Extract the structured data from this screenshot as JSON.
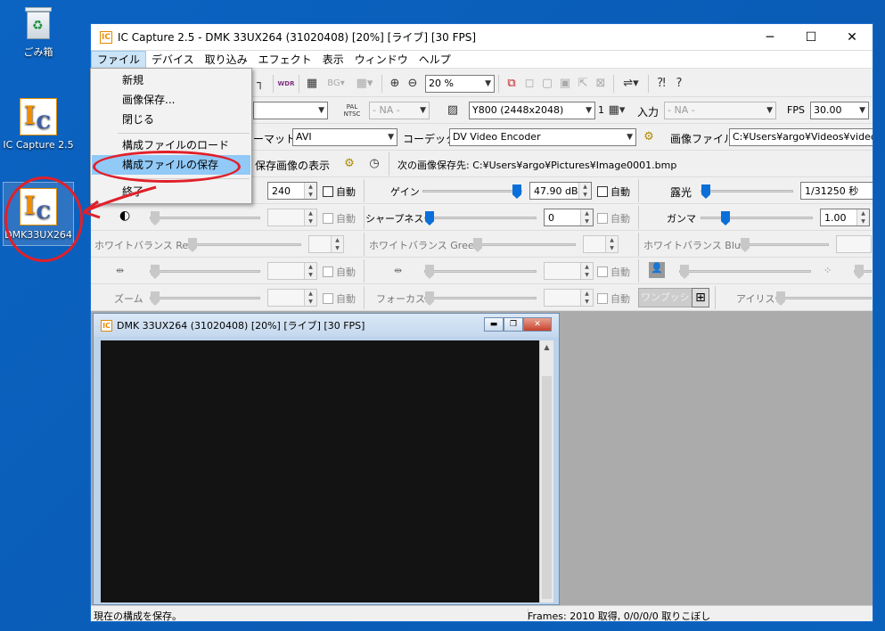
{
  "desktop": {
    "recycle_bin": "ごみ箱",
    "ic_capture": "IC Capture 2.5",
    "dmk_camera": "DMK33UX264"
  },
  "window": {
    "title": "IC Capture 2.5 - DMK 33UX264 (31020408) [20%] [ライブ] [30 FPS]",
    "menu": [
      "ファイル",
      "デバイス",
      "取り込み",
      "エフェクト",
      "表示",
      "ウィンドウ",
      "ヘルプ"
    ]
  },
  "file_menu": {
    "items": [
      "新規",
      "画像保存...",
      "閉じる",
      "構成ファイルのロード",
      "構成ファイルの保存",
      "終了"
    ],
    "highlighted": "構成ファイルの保存"
  },
  "toolbar1": {
    "wdr": "WDR",
    "bg": "BG",
    "zoom": "20 %"
  },
  "toolbar2": {
    "pal_ntsc": "PAL NTSC",
    "na1": "- NA -",
    "format": "Y800 (2448x2048)",
    "binning": "1",
    "input_label": "入力",
    "na2": "- NA -",
    "fps_label": "FPS",
    "fps_value": "30.00"
  },
  "toolbar3": {
    "format_label": "ーマット",
    "format_value": "AVI",
    "codec_label": "コーデック",
    "codec_value": "DV Video Encoder",
    "image_file_label": "画像ファイル",
    "image_file_path": "C:¥Users¥argo¥Videos¥video.av"
  },
  "toolbar4": {
    "show_saved": "保存画像の表示",
    "next_image": "次の画像保存先: C:¥Users¥argo¥Pictures¥Image0001.bmp"
  },
  "properties": {
    "auto": "自動",
    "brightness_value": "240",
    "gain_label": "ゲイン",
    "gain_value": "47.90 dB",
    "exposure_label": "露光",
    "exposure_value": "1/31250 秒",
    "sharpness_label": "シャープネス",
    "sharpness_value": "0",
    "gamma_label": "ガンマ",
    "gamma_value": "1.00",
    "wb_red": "ホワイトバランス Red",
    "wb_green": "ホワイトバランス Green",
    "wb_blue": "ホワイトバランス Blue",
    "zoom_label": "ズーム",
    "focus_label": "フォーカス",
    "one_push": "ワンプッシュ",
    "iris_label": "アイリス"
  },
  "child": {
    "title": "DMK 33UX264 (31020408) [20%] [ライブ] [30 FPS]"
  },
  "status": {
    "left": "現在の構成を保存。",
    "right": "Frames: 2010 取得, 0/0/0/0 取りこぼし"
  },
  "colors": {
    "desktop": "#0a5fb8",
    "annotation": "#e0202a",
    "menu_highlight": "#91c9f7",
    "slider_thumb": "#0a6fd8"
  }
}
